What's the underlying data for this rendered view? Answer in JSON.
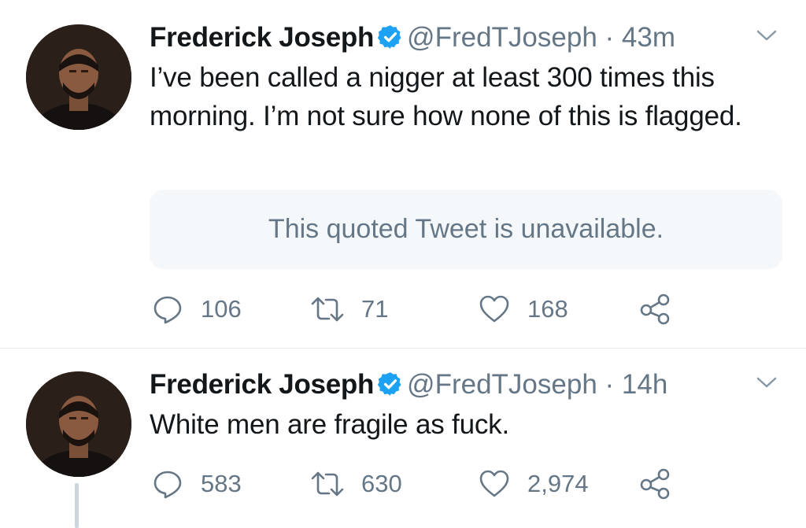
{
  "tweets": [
    {
      "author_name": "Frederick Joseph",
      "handle": "@FredTJoseph",
      "separator": "·",
      "time": "43m",
      "text": "I’ve been called a nigger at least 300 times this morning. I’m not sure how none of this is flagged.",
      "quoted_tweet": "This quoted Tweet is unavailable.",
      "counts": {
        "replies": "106",
        "retweets": "71",
        "likes": "168"
      }
    },
    {
      "author_name": "Frederick Joseph",
      "handle": "@FredTJoseph",
      "separator": "·",
      "time": "14h",
      "text": "White men are fragile as fuck.",
      "counts": {
        "replies": "583",
        "retweets": "630",
        "likes": "2,974"
      }
    }
  ],
  "icons": {
    "verified": "verified-badge-icon",
    "menu": "chevron-down-icon",
    "reply": "reply-icon",
    "retweet": "retweet-icon",
    "like": "heart-icon",
    "share": "share-icon"
  },
  "colors": {
    "text_primary": "#14171a",
    "text_secondary": "#657786",
    "verified_blue": "#1da1f2",
    "quote_background": "#f5f8fa",
    "divider": "#e6ecf0",
    "thread_line": "#ccd6dd"
  }
}
